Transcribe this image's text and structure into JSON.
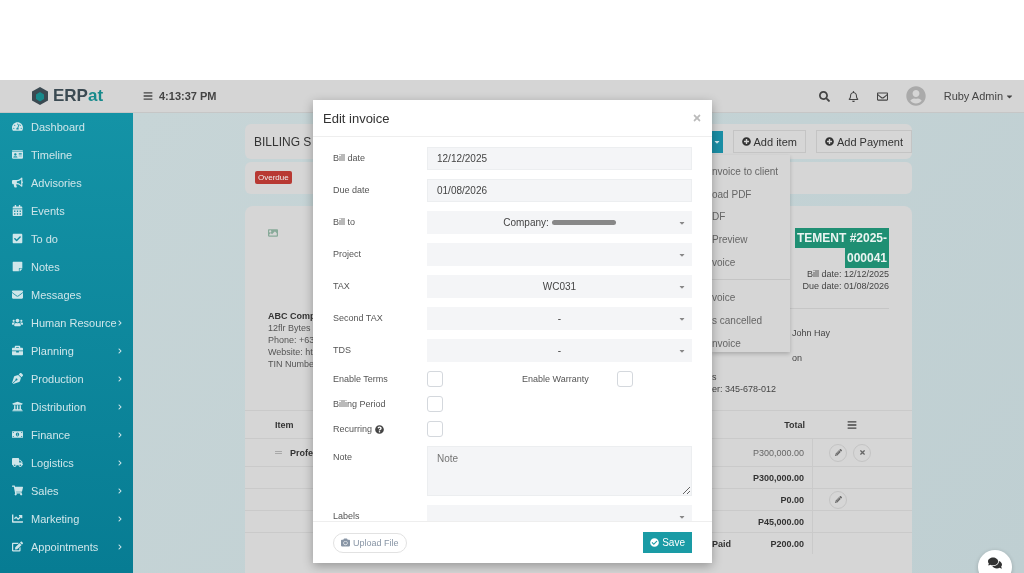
{
  "header": {
    "logo": [
      "ERP",
      "at"
    ],
    "time": "4:13:37 PM",
    "user": "Ruby Admin"
  },
  "sidebar": {
    "items": [
      {
        "label": "Dashboard",
        "has_children": false
      },
      {
        "label": "Timeline",
        "has_children": false
      },
      {
        "label": "Advisories",
        "has_children": false
      },
      {
        "label": "Events",
        "has_children": false
      },
      {
        "label": "To do",
        "has_children": false
      },
      {
        "label": "Notes",
        "has_children": false
      },
      {
        "label": "Messages",
        "has_children": false
      },
      {
        "label": "Human Resource",
        "has_children": true
      },
      {
        "label": "Planning",
        "has_children": true
      },
      {
        "label": "Production",
        "has_children": true
      },
      {
        "label": "Distribution",
        "has_children": true
      },
      {
        "label": "Finance",
        "has_children": true
      },
      {
        "label": "Logistics",
        "has_children": true
      },
      {
        "label": "Sales",
        "has_children": true
      },
      {
        "label": "Marketing",
        "has_children": true
      },
      {
        "label": "Appointments",
        "has_children": true
      }
    ]
  },
  "page": {
    "title": "BILLING S",
    "buttons": [
      "Add item",
      "Add Payment"
    ],
    "status": "Overdue",
    "menu": {
      "groups": [
        [
          "nvoice to client",
          "oad PDF",
          "DF",
          "Preview",
          "voice"
        ],
        [
          "voice",
          "s cancelled",
          "nvoice"
        ]
      ]
    },
    "invoice": {
      "title": [
        "TEMENT #2025-",
        "000041"
      ],
      "dates": [
        "Bill date: 12/12/2025",
        "Due date: 01/08/2026"
      ],
      "company": {
        "name": "ABC Comp",
        "lines": [
          "12flr Bytes",
          "Phone: +63",
          "Website: ht",
          "TIN Numbe"
        ]
      },
      "contact": [
        "John Hay",
        "on"
      ],
      "client": [
        "s",
        "er: 345-678-012"
      ]
    },
    "table": {
      "columns": [
        "Item",
        "Total"
      ],
      "item_rows": [
        "Profe"
      ],
      "rows": [
        {
          "amount": "P300,000.00",
          "bold": false,
          "actions": [
            {
              "kind": "edit"
            },
            {
              "kind": "delete"
            }
          ]
        },
        {
          "amount": "P300,000.00",
          "bold": true,
          "actions": []
        },
        {
          "amount": "P0.00",
          "bold": true,
          "actions": [
            {
              "kind": "edit"
            }
          ]
        },
        {
          "amount": "P45,000.00",
          "bold": true,
          "actions": []
        },
        {
          "label": "Paid",
          "amount": "P200.00",
          "bold": true,
          "actions": []
        }
      ]
    }
  },
  "modal": {
    "title": "Edit invoice",
    "fields": [
      {
        "kind": "input",
        "label": "Bill date",
        "value": "12/12/2025"
      },
      {
        "kind": "input",
        "label": "Due date",
        "value": "01/08/2026"
      },
      {
        "kind": "select",
        "label": "Bill to",
        "value": "Company:",
        "redacted": true
      },
      {
        "kind": "select",
        "label": "Project"
      },
      {
        "kind": "select",
        "label": "TAX",
        "value": "WC031"
      },
      {
        "kind": "select",
        "label": "Second TAX",
        "value": "-"
      },
      {
        "kind": "select",
        "label": "TDS",
        "value": "-"
      },
      {
        "kind": "checks",
        "items": [
          {
            "label": "Enable Terms",
            "checked": false
          },
          {
            "label": "Enable Warranty",
            "checked": false
          }
        ]
      },
      {
        "kind": "checks",
        "items": [
          {
            "label": "Billing Period",
            "checked": false
          }
        ]
      },
      {
        "kind": "checks",
        "items": [
          {
            "label": "Recurring",
            "checked": false,
            "help": true
          }
        ]
      },
      {
        "kind": "textarea",
        "label": "Note",
        "placeholder": "Note"
      },
      {
        "kind": "select",
        "label": "Labels"
      }
    ],
    "upload": "Upload File",
    "save": "Save"
  }
}
